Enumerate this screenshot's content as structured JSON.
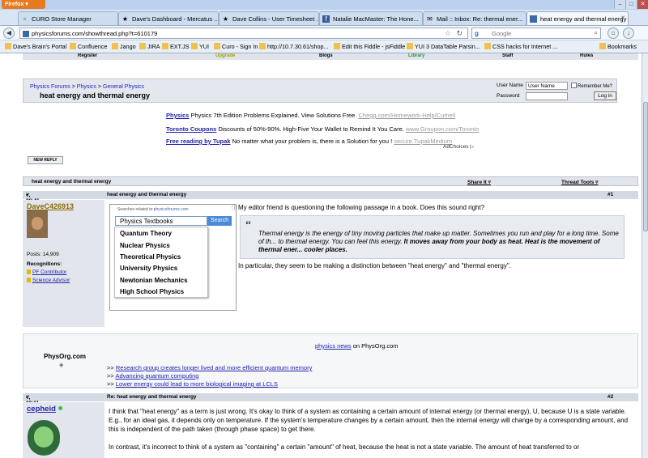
{
  "window": {
    "firefox_label": "Firefox ▾"
  },
  "tabs": [
    {
      "label": "CURO Store Manager",
      "icon": "page-icon"
    },
    {
      "label": "Dave's Dashboard - Mercatus ...",
      "icon": "star-icon"
    },
    {
      "label": "Dave Collins - User Timesheet ...",
      "icon": "star-icon"
    },
    {
      "label": "Natalie MacMaster: The Hone...",
      "icon": "facebook-icon"
    },
    {
      "label": "Mail :: Inbox: Re: thermal ener...",
      "icon": "mail-icon"
    },
    {
      "label": "heat energy and thermal energy",
      "icon": "pf-icon"
    }
  ],
  "navbar": {
    "url": "physicsforums.com/showthread.php?t=610179",
    "search_placeholder": "Google",
    "google_glyph": "g"
  },
  "bookmarks": [
    "Dave's Brain's Portal",
    "Confluence",
    "Jango",
    "JIRA",
    "EXT.JS",
    "YUI",
    "Curo - Sign In",
    "http://10.7.30.61/shop...",
    "Edit this Fiddle - jsFiddle",
    "YUI 3 DataTable Parsin...",
    "CSS hacks for Internet ...",
    "Bookmarks"
  ],
  "site_nav": [
    "Register",
    "Upgrade",
    "Blogs",
    "Library",
    "Staff",
    "Rules"
  ],
  "breadcrumb": {
    "items": [
      "Physics Forums",
      "Physics",
      "General Physics"
    ],
    "separator": ">",
    "thread_title": "heat energy and thermal energy"
  },
  "login": {
    "username_label": "User Name",
    "username_value": "User Name",
    "password_label": "Password",
    "remember_label": "Remember Me?",
    "button": "Log in"
  },
  "ads": [
    {
      "link": "Physics",
      "text": "Physics 7th Edition Problems Explained. View Solutions Free.",
      "url": "Chegg.com/Homework-Help/Cutnell"
    },
    {
      "link": "Toronto Coupons",
      "text": "Discounts of 50%-90%. High-Five Your Wallet to Remind It You Care.",
      "url": "www.Groupon.com/Toronto"
    },
    {
      "link": "Free reading by Tupak",
      "text": "No matter what your problem is, there is a Solution for you !",
      "url": "secure.TupakMedium"
    }
  ],
  "ad_choices": "AdChoices ▷",
  "new_reply": "NEW REPLY",
  "thread_bar": {
    "title": "heat energy and thermal energy",
    "share": "Share It ▿",
    "tools": "Thread Tools ▿"
  },
  "post1": {
    "date": "Y, 08:46 PM",
    "title": "heat energy and thermal energy",
    "number": "#1",
    "author": "DaveC426913",
    "posts": "Posts: 14,909",
    "recognitions_label": "Recognitions:",
    "recognitions": [
      "PF Contributor",
      "Science Advisor"
    ],
    "intro": "My editor friend is questioning the following passage in a book. Does this sound right?",
    "quote": "Thermal energy is the energy of tiny moving particles that make up matter. Sometimes you run and play for a long time. Some of th... to thermal energy. You can feel this energy.",
    "quote_bold": "It moves away from your body as heat. Heat is the movement of thermal ener... cooler places.",
    "followup": "In particular, they seem to be making a distinction between \"heat energy\" and \"thermal energy\"."
  },
  "search_dropdown": {
    "header": "Searches related to",
    "site": "physicsforums.com",
    "query": "Physics Textbooks",
    "button": "Search",
    "options": [
      "Quantum Theory",
      "Nuclear Physics",
      "Theoretical Physics",
      "University Physics",
      "Newtonian Mechanics",
      "High School Physics"
    ]
  },
  "physorg": {
    "logo": "PhysOrg.com",
    "title_link": "physics news",
    "title_rest": "on PhysOrg.com",
    "bullet": ">>",
    "news": [
      "Research group creates longer lived and more efficient quantum memory",
      "Advancing quantum computing",
      "Lower energy could lead to more biological imaging at LCLS"
    ]
  },
  "post2": {
    "date": "Y, 09:11 PM",
    "title": "Re: heat energy and thermal energy",
    "number": "#2",
    "author": "cepheid",
    "body1": "I think that \"heat energy\" as a term is just wrong. It's okay to think of a system as containing a certain amount of internal energy (or thermal energy), U, because U is a state variable. E.g., for an ideal gas, it depends only on temperature. If the system's temperature changes by a certain amount, then the internal energy will change by a corresponding amount, and this is independent of the path taken (through phase space) to get there.",
    "body2": "In contrast, it's incorrect to think of a system as \"containing\" a certain \"amount\" of heat, because the heat is not a state variable. The amount of heat transferred to or"
  }
}
